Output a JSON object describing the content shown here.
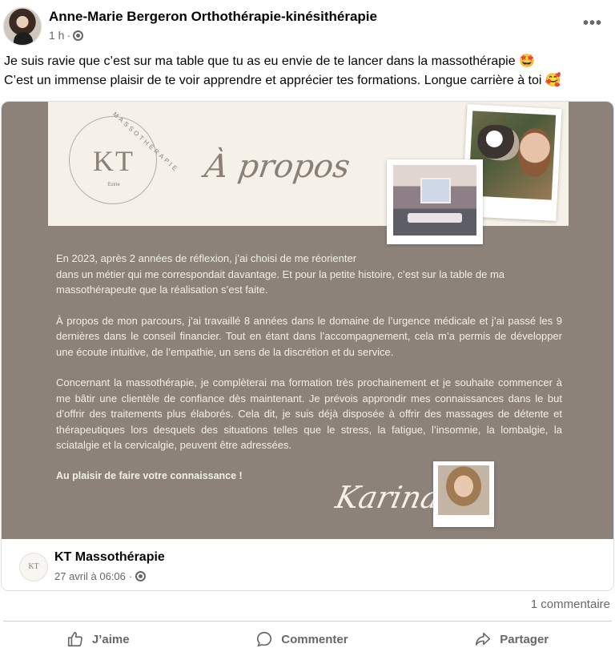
{
  "post": {
    "author": "Anne-Marie Bergeron Orthothérapie-kinésithérapie",
    "time": "1 h",
    "privacy_icon": "globe-icon",
    "more_icon": "more-options-icon",
    "text_line1": "Je suis ravie que c’est sur ma table que tu as eu envie de te lancer dans la massothérapie 🤩",
    "text_line2": "C’est un immense plaisir de te voir apprendre et apprécier tes formations. Longue carrière à toi 🥰"
  },
  "shared_image": {
    "logo_kt": "KT",
    "logo_arc": "MASSOTHÉRAPIE",
    "logo_estrie": "Estrie",
    "heading": "À propos",
    "paragraph1": "En 2023,  après 2 années de réflexion, j’ai choisi de me réorienter\ndans un métier qui me correspondait davantage. Et pour la petite histoire, c’est sur la table de ma massothérapeute que la réalisation s’est faite.",
    "paragraph2": "À propos de mon parcours, j’ai travaillé 8 années dans le domaine de l’urgence médicale et j’ai passé les 9 dernières dans le conseil financier. Tout en étant dans l’accompagnement, cela m’a permis de développer une écoute intuitive, de l’empathie, un sens de la discrétion et du service.",
    "paragraph3": "Concernant la massothérapie, je complèterai ma formation très prochainement et je souhaite commencer à me bâtir une clientèle de confiance dès maintenant. Je prévois approndir mes connaissances dans le but d’offrir des traitements plus élaborés. Cela dit, je suis déjà disposée à offrir des massages de détente et thérapeutiques lors desquels des situations telles que le stress, la fatigue, l’insomnie, la lombalgie, la sciatalgie et la cervicalgie, peuvent être adressées.",
    "closing": "Au plaisir de faire votre connaissance !",
    "signature": "Karina"
  },
  "shared_page": {
    "name": "KT Massothérapie",
    "logo_text": "KT",
    "date": "27 avril à 06:06"
  },
  "engagement": {
    "comments": "1 commentaire"
  },
  "actions": {
    "like": "J’aime",
    "comment": "Commenter",
    "share": "Partager"
  }
}
